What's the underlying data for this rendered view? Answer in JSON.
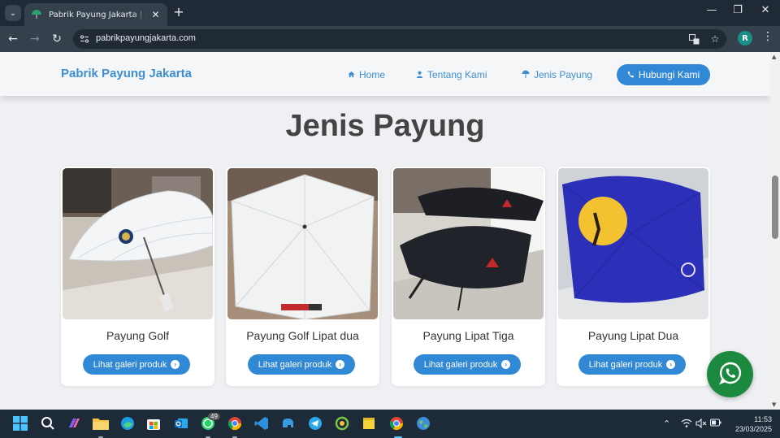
{
  "browser": {
    "tab_title": "Pabrik Payung Jakarta | Produsen Payung Promosi",
    "url": "pabrikpayungjakarta.com",
    "tab_close": "✕",
    "new_tab": "+",
    "minimize": "—",
    "maximize": "❐",
    "close": "✕",
    "profile_initial": "R"
  },
  "header": {
    "brand": "Pabrik Payung Jakarta",
    "nav": [
      {
        "label": "Home",
        "icon": "home-icon"
      },
      {
        "label": "Tentang Kami",
        "icon": "user-icon"
      },
      {
        "label": "Jenis Payung",
        "icon": "umbrella-icon"
      }
    ],
    "cta_label": "Hubungi Kami",
    "cta_icon": "phone-icon"
  },
  "section": {
    "title": "Jenis Payung",
    "products": [
      {
        "title": "Payung Golf",
        "button": "Lihat galeri produk"
      },
      {
        "title": "Payung Golf Lipat dua",
        "button": "Lihat galeri produk"
      },
      {
        "title": "Payung Lipat Tiga",
        "button": "Lihat galeri produk"
      },
      {
        "title": "Payung Lipat Dua",
        "button": "Lihat galeri produk"
      }
    ]
  },
  "taskbar": {
    "whatsapp_badge": "49",
    "time": "11:53",
    "date": "23/03/2025"
  },
  "colors": {
    "accent": "#3189d6",
    "brand": "#3d8fd1",
    "whatsapp": "#1c8a3e"
  }
}
